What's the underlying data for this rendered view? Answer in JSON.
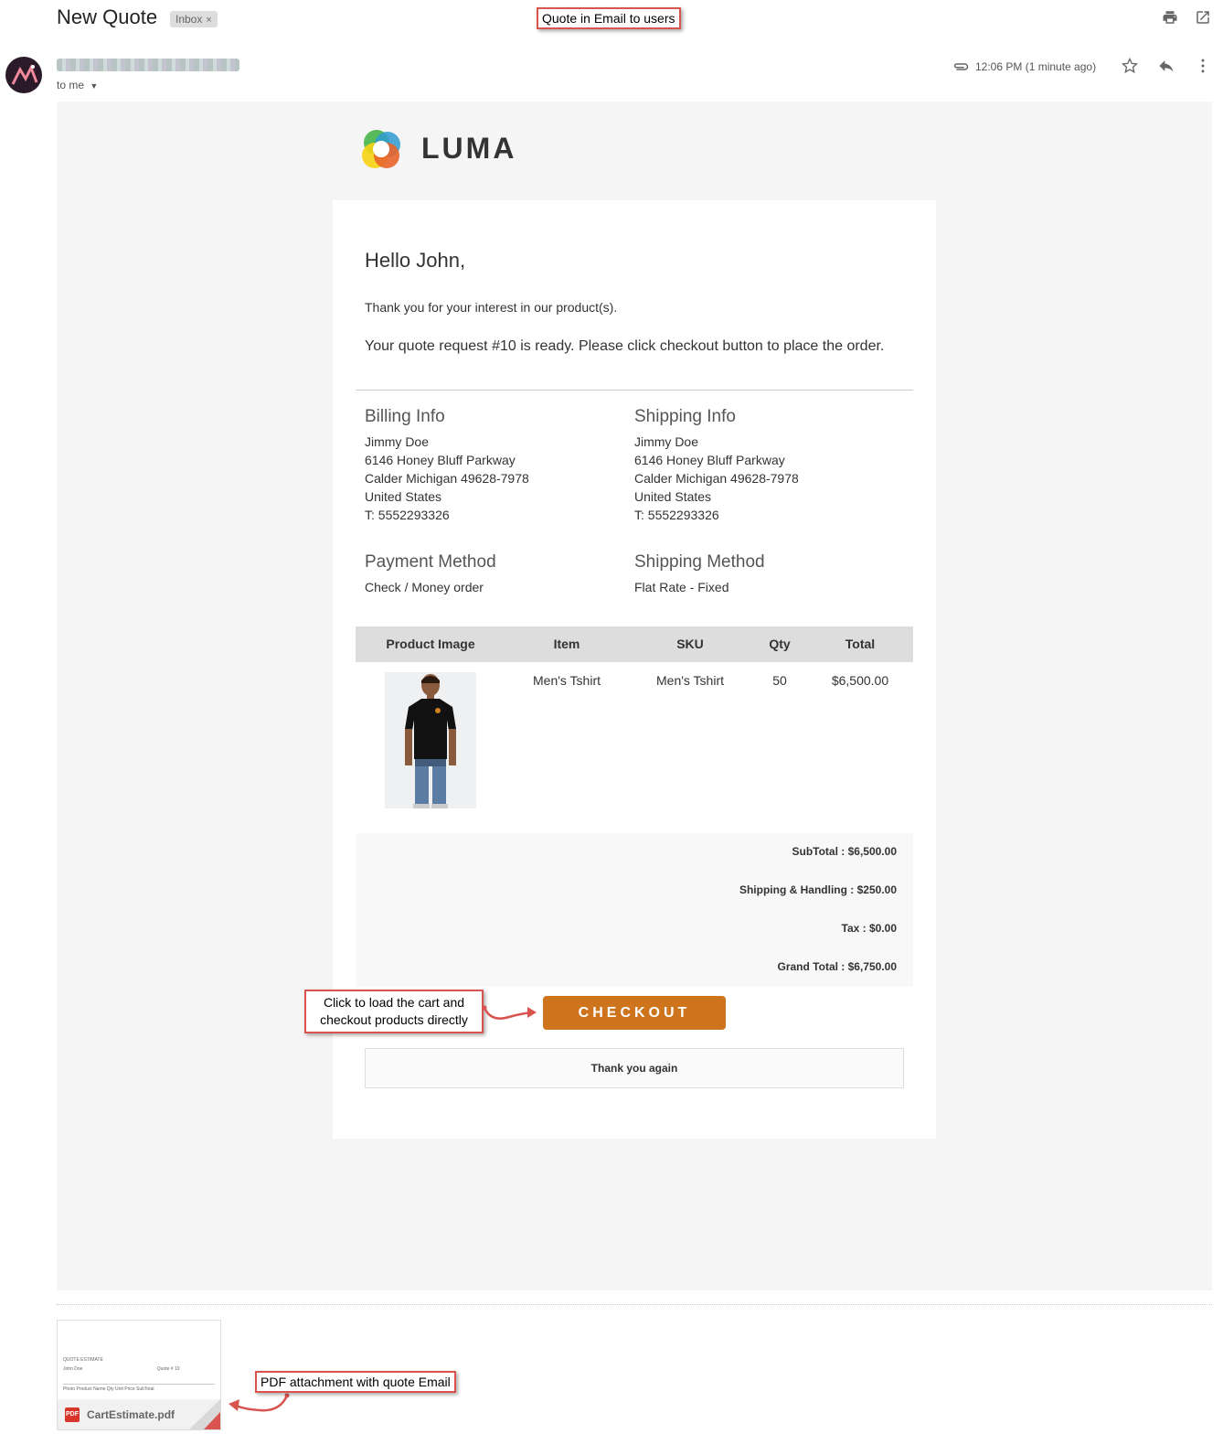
{
  "header": {
    "subject": "New Quote",
    "inbox_label": "Inbox",
    "inbox_close": "×",
    "annotation_title": "Quote in Email to users",
    "to_me": "to me",
    "time": "12:06 PM (1 minute ago)"
  },
  "email": {
    "brand": "LUMA",
    "greeting": "Hello John,",
    "thanks": "Thank you for your interest in our product(s).",
    "ready": "Your quote request #10 is ready. Please click checkout button to place the order.",
    "billing": {
      "heading": "Billing Info",
      "name": "Jimmy Doe",
      "street": "6146 Honey Bluff Parkway",
      "city": "Calder Michigan 49628-7978",
      "country": "United States",
      "phone": "T: 5552293326"
    },
    "shipping": {
      "heading": "Shipping Info",
      "name": "Jimmy Doe",
      "street": "6146 Honey Bluff Parkway",
      "city": "Calder Michigan 49628-7978",
      "country": "United States",
      "phone": "T: 5552293326"
    },
    "payment": {
      "heading": "Payment Method",
      "value": "Check / Money order"
    },
    "shipping_method": {
      "heading": "Shipping Method",
      "value": "Flat Rate - Fixed"
    },
    "table": {
      "headers": [
        "Product Image",
        "Item",
        "SKU",
        "Qty",
        "Total"
      ],
      "row": {
        "item": "Men's Tshirt",
        "sku": "Men's Tshirt",
        "qty": "50",
        "total": "$6,500.00"
      }
    },
    "totals": {
      "subtotal": "SubTotal : $6,500.00",
      "shipping": "Shipping & Handling : $250.00",
      "tax": "Tax : $0.00",
      "grand": "Grand Total : $6,750.00"
    },
    "checkout_label": "CHECKOUT",
    "annotation_checkout": "Click to load the cart and checkout products directly",
    "thank_you": "Thank you again"
  },
  "attachment": {
    "filename": "CartEstimate.pdf",
    "badge": "PDF",
    "preview_title": "QUOTE ESTIMATE",
    "preview_name": "John Doe",
    "preview_quote": "Quote # 10",
    "preview_cols": "Photo   Product Name   Qty   Unit Price   SubTotal",
    "annotation": "PDF attachment with quote Email"
  },
  "colors": {
    "checkout": "#cd741d",
    "annotation_border": "#d9534f",
    "email_bg": "#f5f5f5"
  }
}
